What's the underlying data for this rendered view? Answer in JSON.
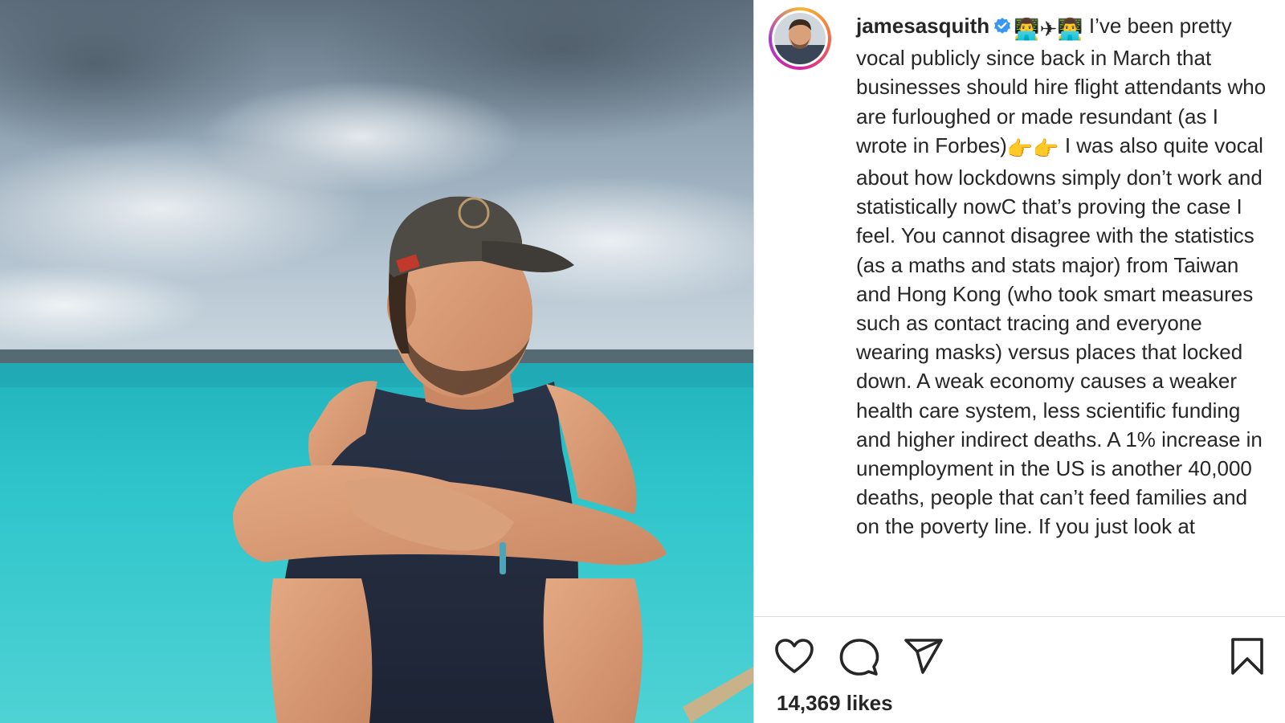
{
  "post": {
    "username": "jamesasquith",
    "caption_emoji_prefix": "👨‍💻✈👨‍💻",
    "caption_text_1": " I’ve been pretty vocal publicly since back in March that businesses should hire flight attendants who are furloughed or made resundant (as I wrote in Forbes)",
    "caption_emoji_mid": "👉👉",
    "caption_text_2": " I was also quite vocal about how lockdowns simply don’t work and statistically nowC that’s proving the case I feel. You cannot disagree with the statistics (as a maths and stats major) from Taiwan and Hong Kong (who took smart measures such as contact tracing and everyone wearing masks) versus places that locked down. A weak economy causes a weaker health care system, less scientific funding and higher indirect deaths. A 1% increase in unemployment in the US is another 40,000 deaths, people that can’t feed families and on the poverty line. If you just look at",
    "likes_text": "14,369 likes"
  },
  "icons": {
    "verified": "verified-badge-icon",
    "like": "heart-icon",
    "comment": "speech-bubble-icon",
    "share": "paper-plane-icon",
    "save": "bookmark-icon"
  },
  "colors": {
    "verified_blue": "#3897f0",
    "text": "#262626",
    "divider": "#dbdbdb",
    "sea": "#2ec4c9",
    "sky": "#9fb4c4"
  }
}
